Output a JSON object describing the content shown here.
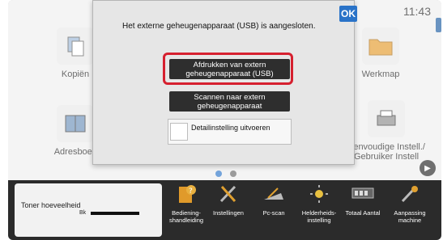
{
  "status": {
    "clock": "11:43"
  },
  "home": {
    "apps": [
      {
        "label": "Kopiën",
        "icon": "copy-icon"
      },
      {
        "label": "Werkmap",
        "icon": "folder-icon"
      },
      {
        "label": "Adresboek",
        "icon": "address-book-icon"
      },
      {
        "label": "Eenvoudige Instell./ Gebruiker Instell",
        "icon": "printer-icon"
      }
    ],
    "page_indicator": {
      "pages": 2,
      "current": 1
    }
  },
  "dialog": {
    "message": "Het externe geheugenapparaat (USB) is aangesloten.",
    "ok_label": "OK",
    "print_button": "Afdrukken van extern geheugenapparaat (USB)",
    "scan_button": "Scannen naar extern geheugenapparaat",
    "detail_label": "Detailinstelling uitvoeren"
  },
  "taskbar": {
    "toner_label": "Toner hoeveelheid",
    "toner_color": "Bk",
    "toner_level": 1.0,
    "items": [
      {
        "label": "Bediening- shandleiding",
        "icon": "manual-icon"
      },
      {
        "label": "Instellingen",
        "icon": "settings-tools-icon"
      },
      {
        "label": "Pc-scan",
        "icon": "pc-scan-icon"
      },
      {
        "label": "Helderheids- instelling",
        "icon": "brightness-icon"
      },
      {
        "label": "Totaal Aantal",
        "icon": "counter-icon"
      },
      {
        "label": "Aanpassing machine",
        "icon": "customize-icon"
      }
    ]
  },
  "colors": {
    "accent_blue": "#2a73c8",
    "highlight_red": "#d6202f",
    "taskbar": "#2b2b2b",
    "dialog_button": "#2e2e2e"
  }
}
